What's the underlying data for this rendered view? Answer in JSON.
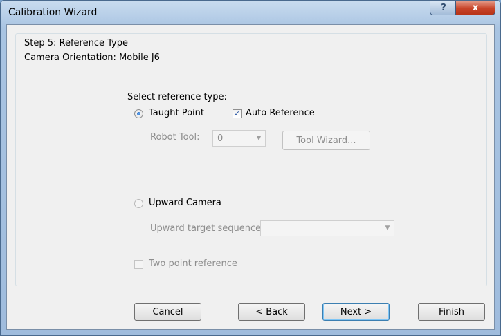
{
  "window": {
    "title": "Calibration Wizard",
    "help_glyph": "?",
    "close_glyph": "x"
  },
  "group": {
    "legend": "Step 5: Reference Type",
    "camera_orientation": "Camera Orientation: Mobile J6"
  },
  "reference": {
    "prompt": "Select reference type:",
    "taught_point_label": "Taught Point",
    "taught_point_selected": true,
    "auto_reference_label": "Auto Reference",
    "auto_reference_checked": true,
    "robot_tool_label": "Robot Tool:",
    "robot_tool_value": "0",
    "tool_wizard_label": "Tool Wizard...",
    "upward_camera_label": "Upward Camera",
    "upward_camera_selected": false,
    "upward_target_label": "Upward target sequence:",
    "upward_target_value": "",
    "two_point_label": "Two point reference",
    "two_point_checked": false
  },
  "buttons": {
    "cancel": "Cancel",
    "back": "< Back",
    "next": "Next >",
    "finish": "Finish"
  },
  "icons": {
    "check": "✓",
    "dropdown": "▼"
  }
}
